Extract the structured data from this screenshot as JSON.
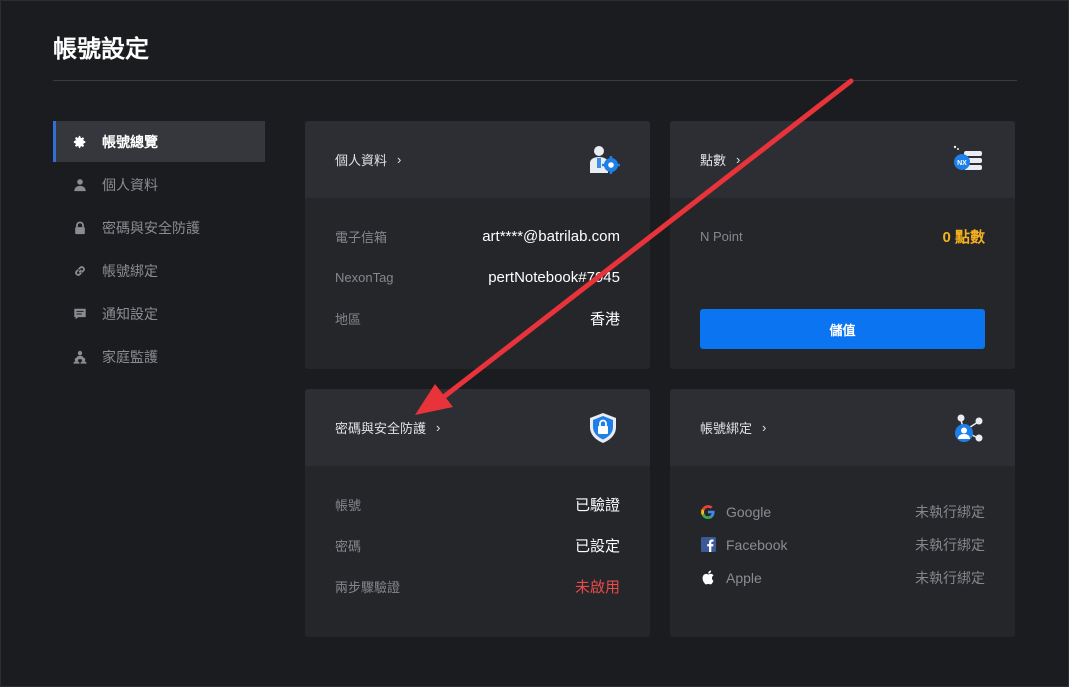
{
  "page": {
    "title": "帳號設定"
  },
  "sidebar": {
    "items": [
      {
        "label": "帳號總覽",
        "icon": "gear-icon",
        "active": true
      },
      {
        "label": "個人資料",
        "icon": "person-icon"
      },
      {
        "label": "密碼與安全防護",
        "icon": "lock-icon"
      },
      {
        "label": "帳號綁定",
        "icon": "link-icon"
      },
      {
        "label": "通知設定",
        "icon": "message-icon"
      },
      {
        "label": "家庭監護",
        "icon": "family-icon"
      }
    ]
  },
  "profile_card": {
    "title": "個人資料",
    "icon": "profile-settings-icon",
    "rows": [
      {
        "label": "電子信箱",
        "value": "art****@batrilab.com"
      },
      {
        "label": "NexonTag",
        "value": "pertNotebook#7945"
      },
      {
        "label": "地區",
        "value": "香港"
      }
    ]
  },
  "points_card": {
    "title": "點數",
    "icon": "nx-points-icon",
    "label": "N Point",
    "value": "0 點數",
    "button": "儲值"
  },
  "security_card": {
    "title": "密碼與安全防護",
    "icon": "shield-lock-icon",
    "rows": [
      {
        "label": "帳號",
        "value": "已驗證"
      },
      {
        "label": "密碼",
        "value": "已設定"
      },
      {
        "label": "兩步驟驗證",
        "value": "未啟用"
      }
    ]
  },
  "binding_card": {
    "title": "帳號綁定",
    "icon": "network-user-icon",
    "rows": [
      {
        "name": "Google",
        "icon": "google-icon",
        "status": "未執行綁定"
      },
      {
        "name": "Facebook",
        "icon": "facebook-icon",
        "status": "未執行綁定"
      },
      {
        "name": "Apple",
        "icon": "apple-icon",
        "status": "未執行綁定"
      }
    ]
  },
  "colors": {
    "accent": "#0b74f1",
    "warning": "#e94a4a",
    "points": "#f3b11e",
    "annotation_arrow": "#e8333a"
  }
}
